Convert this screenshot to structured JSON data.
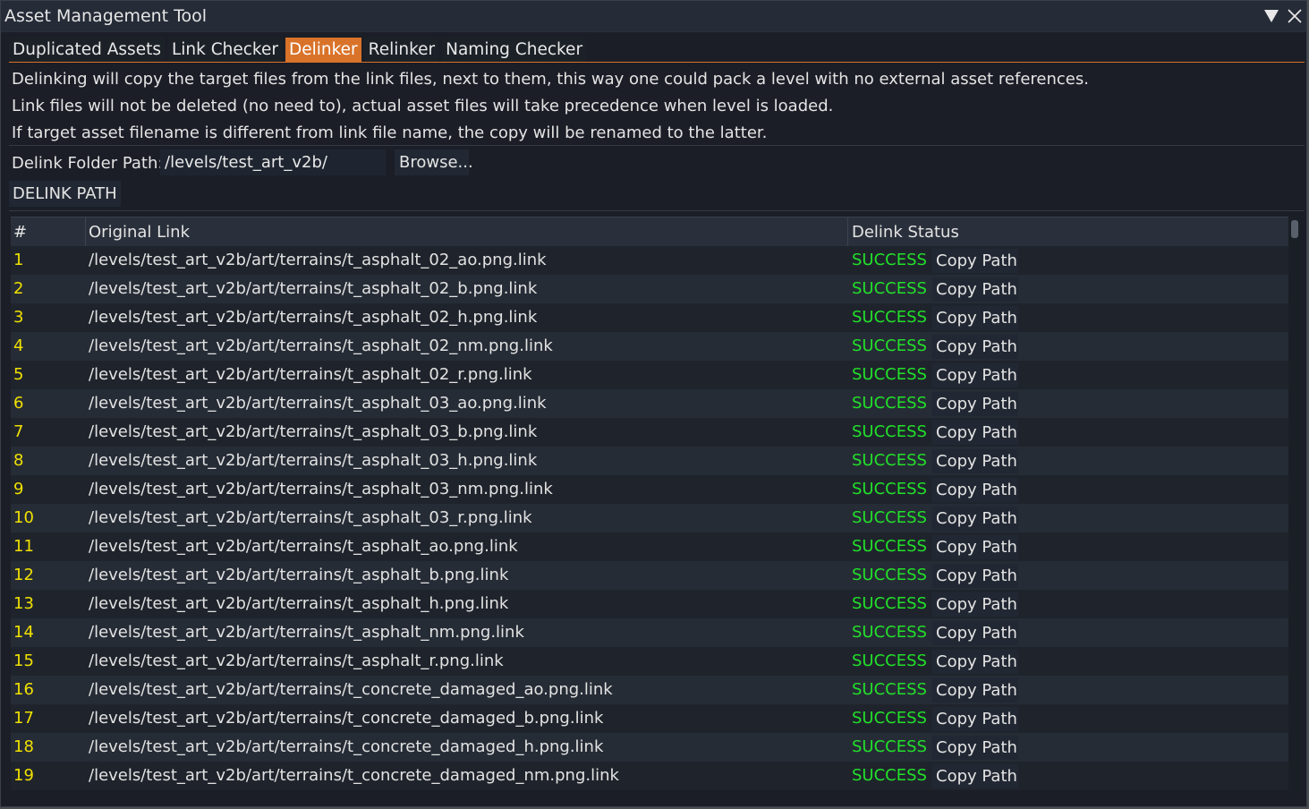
{
  "window": {
    "title": "Asset Management Tool",
    "collapse_icon": "triangle-down-icon",
    "close_icon": "close-x-icon"
  },
  "tabs": [
    {
      "label": "Duplicated Assets",
      "active": false
    },
    {
      "label": "Link Checker",
      "active": false
    },
    {
      "label": "Delinker",
      "active": true
    },
    {
      "label": "Relinker",
      "active": false
    },
    {
      "label": "Naming Checker",
      "active": false
    }
  ],
  "description": [
    "Delinking will copy the target files from the link files, next to them, this way one could pack a level with no external asset references.",
    "Link files will not be deleted (no need to), actual asset files will take precedence when level is loaded.",
    "If target asset filename is different from link file name, the copy will be renamed to the latter."
  ],
  "path_field": {
    "label": "Delink Folder Path:",
    "value": "/levels/test_art_v2b/",
    "browse_label": "Browse..."
  },
  "delink_button": "DELINK PATH",
  "table": {
    "headers": {
      "num": "#",
      "link": "Original Link",
      "status": "Delink Status"
    },
    "copy_label": "Copy Path",
    "rows": [
      {
        "num": "1",
        "link": "/levels/test_art_v2b/art/terrains/t_asphalt_02_ao.png.link",
        "status": "SUCCESS"
      },
      {
        "num": "2",
        "link": "/levels/test_art_v2b/art/terrains/t_asphalt_02_b.png.link",
        "status": "SUCCESS"
      },
      {
        "num": "3",
        "link": "/levels/test_art_v2b/art/terrains/t_asphalt_02_h.png.link",
        "status": "SUCCESS"
      },
      {
        "num": "4",
        "link": "/levels/test_art_v2b/art/terrains/t_asphalt_02_nm.png.link",
        "status": "SUCCESS"
      },
      {
        "num": "5",
        "link": "/levels/test_art_v2b/art/terrains/t_asphalt_02_r.png.link",
        "status": "SUCCESS"
      },
      {
        "num": "6",
        "link": "/levels/test_art_v2b/art/terrains/t_asphalt_03_ao.png.link",
        "status": "SUCCESS"
      },
      {
        "num": "7",
        "link": "/levels/test_art_v2b/art/terrains/t_asphalt_03_b.png.link",
        "status": "SUCCESS"
      },
      {
        "num": "8",
        "link": "/levels/test_art_v2b/art/terrains/t_asphalt_03_h.png.link",
        "status": "SUCCESS"
      },
      {
        "num": "9",
        "link": "/levels/test_art_v2b/art/terrains/t_asphalt_03_nm.png.link",
        "status": "SUCCESS"
      },
      {
        "num": "10",
        "link": "/levels/test_art_v2b/art/terrains/t_asphalt_03_r.png.link",
        "status": "SUCCESS"
      },
      {
        "num": "11",
        "link": "/levels/test_art_v2b/art/terrains/t_asphalt_ao.png.link",
        "status": "SUCCESS"
      },
      {
        "num": "12",
        "link": "/levels/test_art_v2b/art/terrains/t_asphalt_b.png.link",
        "status": "SUCCESS"
      },
      {
        "num": "13",
        "link": "/levels/test_art_v2b/art/terrains/t_asphalt_h.png.link",
        "status": "SUCCESS"
      },
      {
        "num": "14",
        "link": "/levels/test_art_v2b/art/terrains/t_asphalt_nm.png.link",
        "status": "SUCCESS"
      },
      {
        "num": "15",
        "link": "/levels/test_art_v2b/art/terrains/t_asphalt_r.png.link",
        "status": "SUCCESS"
      },
      {
        "num": "16",
        "link": "/levels/test_art_v2b/art/terrains/t_concrete_damaged_ao.png.link",
        "status": "SUCCESS"
      },
      {
        "num": "17",
        "link": "/levels/test_art_v2b/art/terrains/t_concrete_damaged_b.png.link",
        "status": "SUCCESS"
      },
      {
        "num": "18",
        "link": "/levels/test_art_v2b/art/terrains/t_concrete_damaged_h.png.link",
        "status": "SUCCESS"
      },
      {
        "num": "19",
        "link": "/levels/test_art_v2b/art/terrains/t_concrete_damaged_nm.png.link",
        "status": "SUCCESS"
      }
    ]
  },
  "colors": {
    "accent": "#d9732a",
    "row_number": "#f0e000",
    "success": "#22e02a"
  }
}
